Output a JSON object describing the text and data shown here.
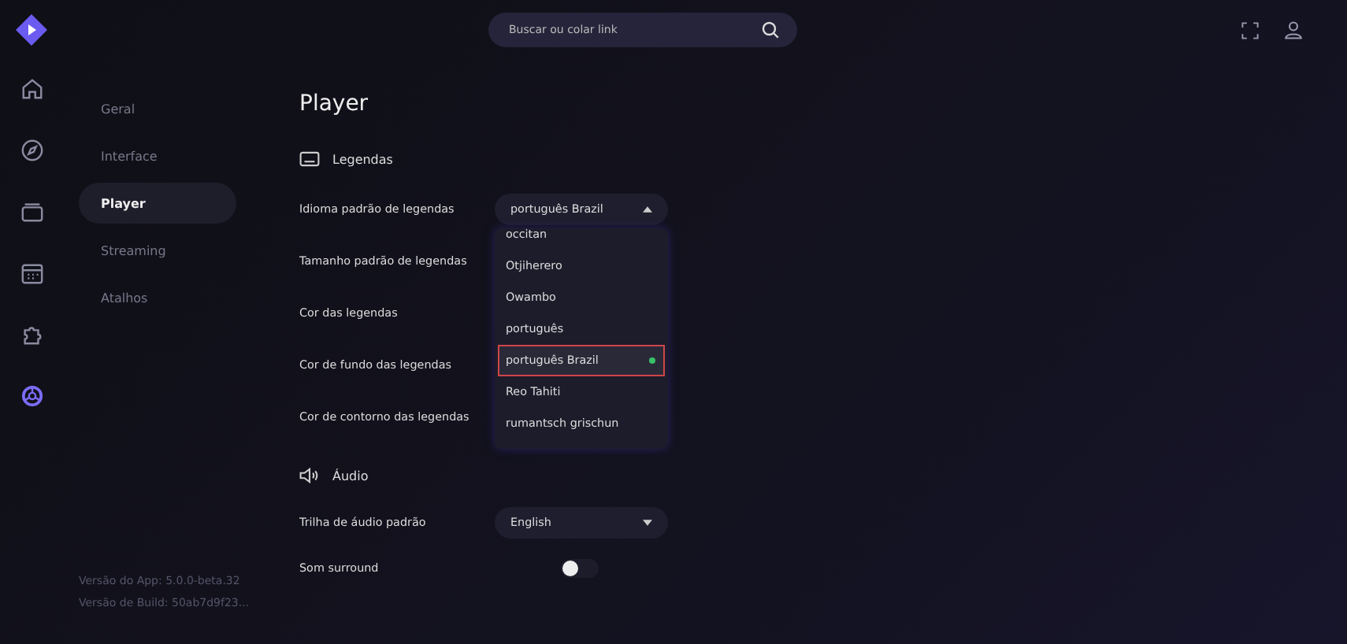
{
  "search": {
    "placeholder": "Buscar ou colar link"
  },
  "rail": [
    {
      "kind": "home",
      "selected": false
    },
    {
      "kind": "discover",
      "selected": false
    },
    {
      "kind": "library",
      "selected": false
    },
    {
      "kind": "calendar",
      "selected": false
    },
    {
      "kind": "addons",
      "selected": false
    },
    {
      "kind": "settings",
      "selected": true
    }
  ],
  "nav": [
    {
      "label": "Geral",
      "selected": false
    },
    {
      "label": "Interface",
      "selected": false
    },
    {
      "label": "Player",
      "selected": true
    },
    {
      "label": "Streaming",
      "selected": false
    },
    {
      "label": "Atalhos",
      "selected": false
    }
  ],
  "versions": [
    "Versão do App: 5.0.0-beta.32",
    "Versão de Build: 50ab7d9f23..."
  ],
  "title": "Player",
  "sections": [
    {
      "kind": "subtitles",
      "title": "Legendas",
      "rows": [
        {
          "label": "Idioma padrão de legendas",
          "kind": "select",
          "value": "português Brazil",
          "expanded": true,
          "options": [
            {
              "label": "occitan",
              "selected": false
            },
            {
              "label": "Otjiherero",
              "selected": false
            },
            {
              "label": "Owambo",
              "selected": false
            },
            {
              "label": "português",
              "selected": false
            },
            {
              "label": "português Brazil",
              "selected": true
            },
            {
              "label": "Reo Tahiti",
              "selected": false
            },
            {
              "label": "rumantsch grischun",
              "selected": false
            }
          ]
        },
        {
          "label": "Tamanho padrão de legendas",
          "kind": "hidden"
        },
        {
          "label": "Cor das legendas",
          "kind": "hidden"
        },
        {
          "label": "Cor de fundo das legendas",
          "kind": "hidden"
        },
        {
          "label": "Cor de contorno das legendas",
          "kind": "hidden"
        }
      ]
    },
    {
      "kind": "audio",
      "title": "Áudio",
      "rows": [
        {
          "label": "Trilha de áudio padrão",
          "kind": "select",
          "value": "English",
          "expanded": false
        },
        {
          "label": "Som surround",
          "kind": "toggle",
          "on": false
        }
      ]
    }
  ]
}
